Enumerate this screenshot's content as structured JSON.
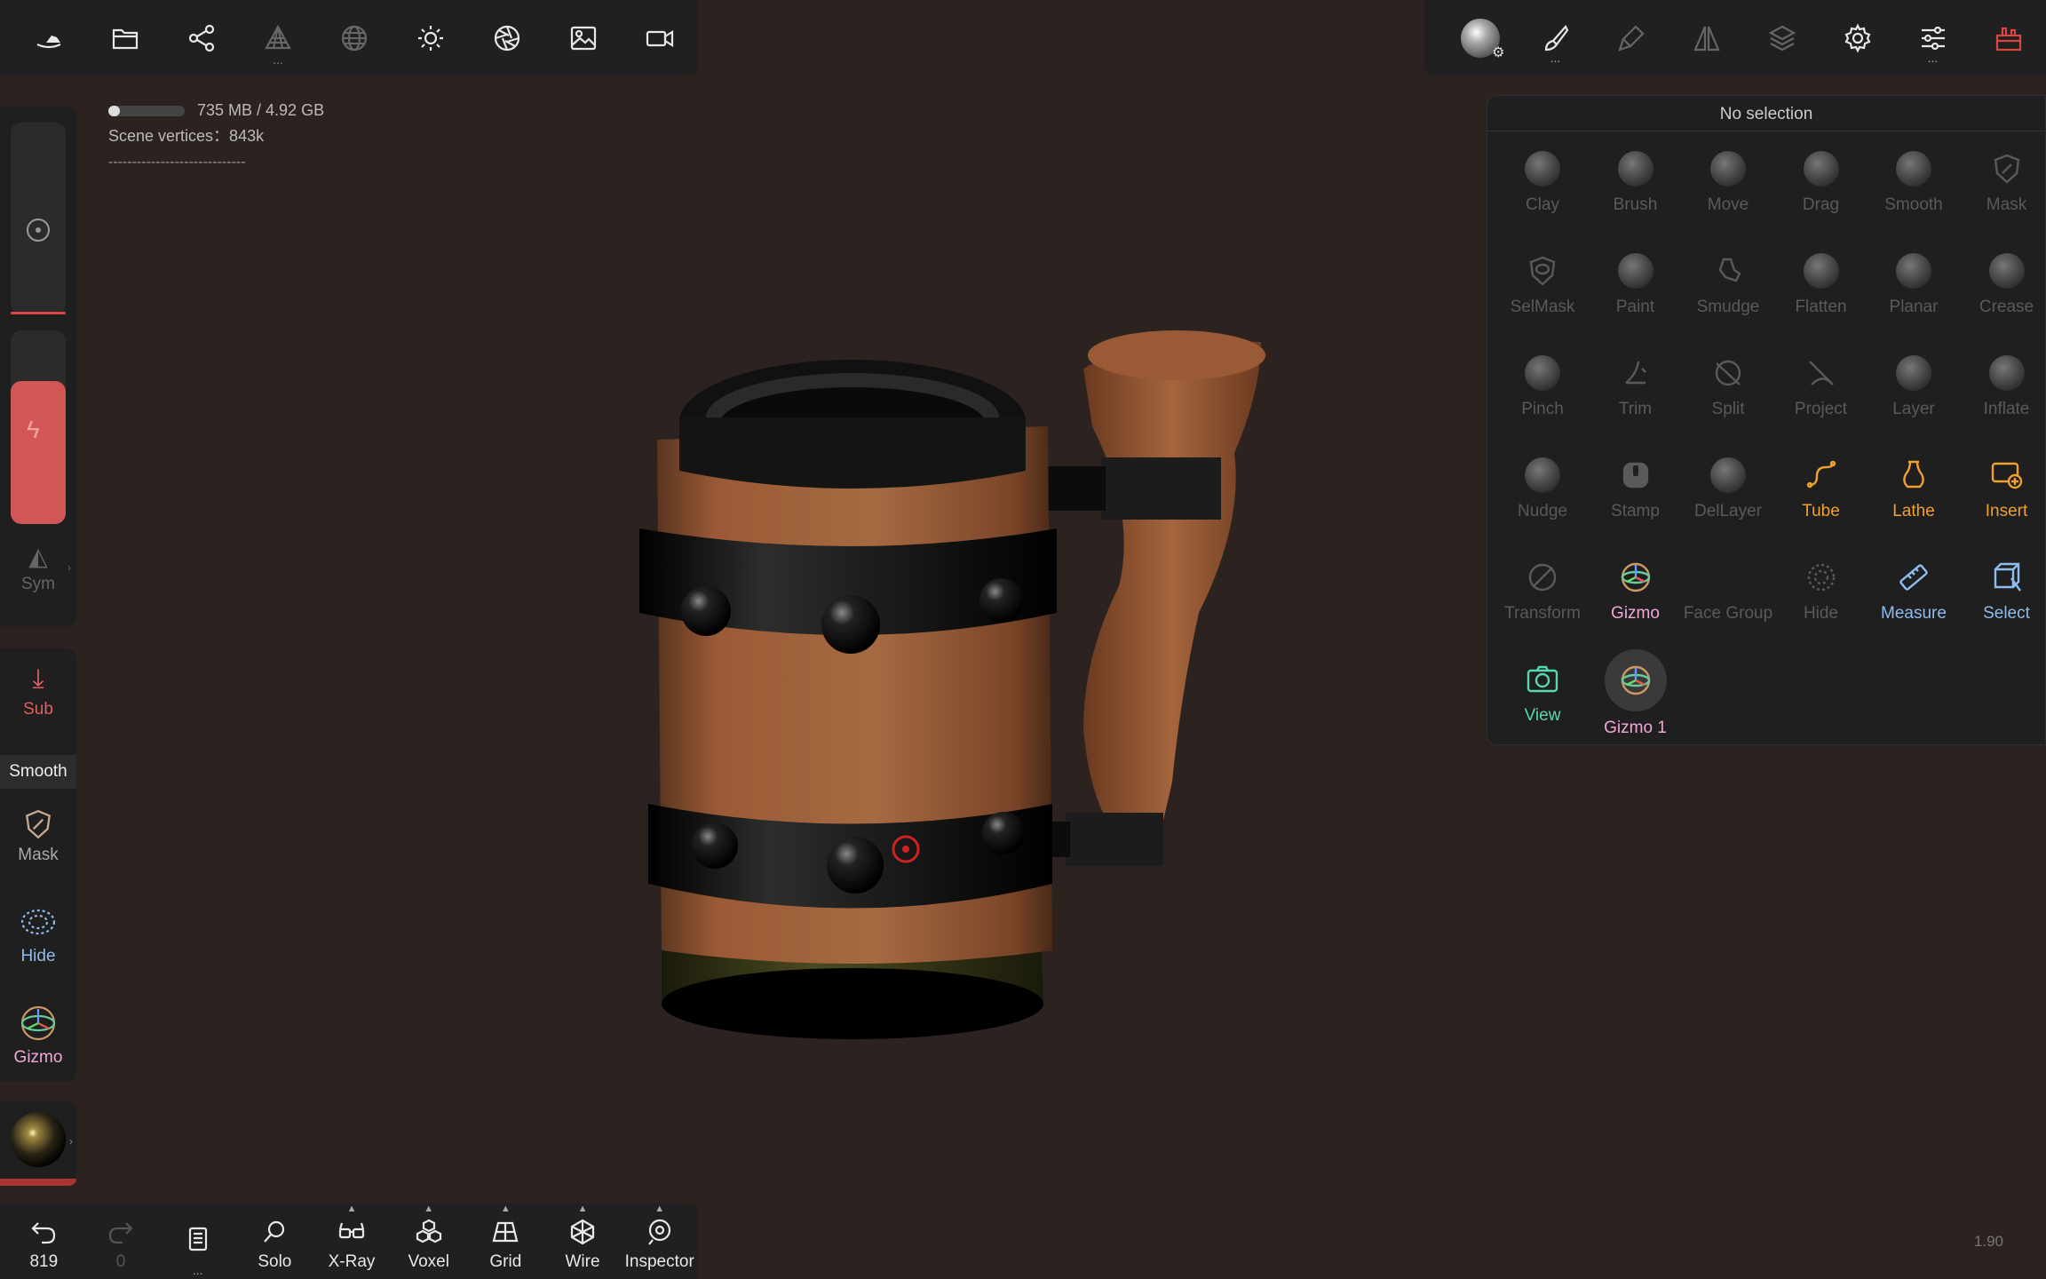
{
  "top_left_toolbar": {
    "items": [
      {
        "name": "nomad-logo-icon",
        "enabled": true
      },
      {
        "name": "folder-icon",
        "enabled": true
      },
      {
        "name": "scene-graph-icon",
        "enabled": true
      },
      {
        "name": "topology-icon",
        "enabled": false
      },
      {
        "name": "wireframe-sphere-icon",
        "enabled": false
      },
      {
        "name": "sun-icon",
        "enabled": true
      },
      {
        "name": "aperture-icon",
        "enabled": true
      },
      {
        "name": "image-icon",
        "enabled": true
      },
      {
        "name": "video-camera-icon",
        "enabled": true
      }
    ]
  },
  "info": {
    "memory": "735 MB / 4.92 GB",
    "memory_fraction": 0.15,
    "vertices": "Scene vertices：843k",
    "dashes": "-----------------------------"
  },
  "left_panel": {
    "radius_value": 0.02,
    "intensity_value": 0.74,
    "sym_label": "Sym"
  },
  "left_tools": {
    "sub_label": "Sub",
    "smooth_label": "Smooth",
    "mask_label": "Mask",
    "hide_label": "Hide",
    "gizmo_label": "Gizmo"
  },
  "bottom_toolbar": {
    "undo_count": "819",
    "redo_count": "0",
    "more_label": "...",
    "solo": "Solo",
    "xray": "X-Ray",
    "voxel": "Voxel",
    "grid": "Grid",
    "wire": "Wire",
    "inspector": "Inspector"
  },
  "tool_panel": {
    "title": "No selection",
    "tools": [
      {
        "label": "Clay",
        "state": "off"
      },
      {
        "label": "Brush",
        "state": "off"
      },
      {
        "label": "Move",
        "state": "off"
      },
      {
        "label": "Drag",
        "state": "off"
      },
      {
        "label": "Smooth",
        "state": "off"
      },
      {
        "label": "Mask",
        "state": "off"
      },
      {
        "label": "SelMask",
        "state": "off"
      },
      {
        "label": "Paint",
        "state": "off"
      },
      {
        "label": "Smudge",
        "state": "off"
      },
      {
        "label": "Flatten",
        "state": "off"
      },
      {
        "label": "Planar",
        "state": "off"
      },
      {
        "label": "Crease",
        "state": "off"
      },
      {
        "label": "Pinch",
        "state": "off"
      },
      {
        "label": "Trim",
        "state": "off"
      },
      {
        "label": "Split",
        "state": "off"
      },
      {
        "label": "Project",
        "state": "off"
      },
      {
        "label": "Layer",
        "state": "off"
      },
      {
        "label": "Inflate",
        "state": "off"
      },
      {
        "label": "Nudge",
        "state": "off"
      },
      {
        "label": "Stamp",
        "state": "off"
      },
      {
        "label": "DelLayer",
        "state": "off"
      },
      {
        "label": "Tube",
        "state": "orange"
      },
      {
        "label": "Lathe",
        "state": "orange"
      },
      {
        "label": "Insert",
        "state": "orange"
      },
      {
        "label": "Transform",
        "state": "off"
      },
      {
        "label": "Gizmo",
        "state": "pink"
      },
      {
        "label": "Face Group",
        "state": "off"
      },
      {
        "label": "Hide",
        "state": "off"
      },
      {
        "label": "Measure",
        "state": "blue"
      },
      {
        "label": "Select",
        "state": "blue"
      },
      {
        "label": "View",
        "state": "green"
      },
      {
        "label": "Gizmo 1",
        "state": "pink-active"
      }
    ]
  },
  "version": "1.90",
  "colors": {
    "background": "#2c2320",
    "panel": "#1f1f1f",
    "accent_red": "#d15656",
    "orange": "#f0a030",
    "blue": "#8fbcee",
    "pink": "#f0a8d8",
    "green": "#56d8b0"
  }
}
